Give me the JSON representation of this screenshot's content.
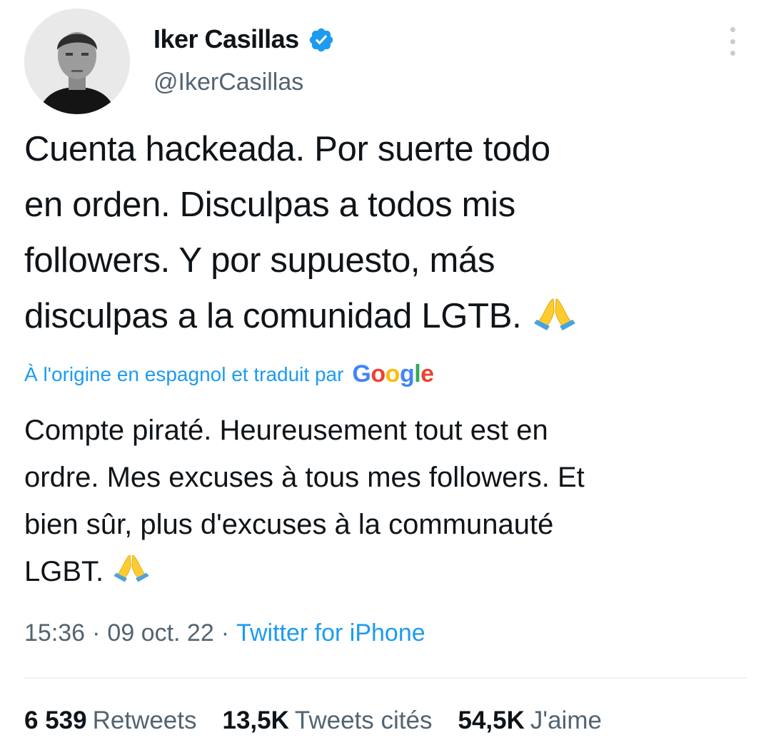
{
  "author": {
    "display_name": "Iker Casillas",
    "handle": "@IkerCasillas",
    "verified": true,
    "verified_color": "#1d9bf0"
  },
  "tweet": {
    "text_lines": [
      "Cuenta hackeada. Por suerte todo",
      "en orden. Disculpas a todos mis",
      "followers. Y por supuesto, más",
      "disculpas a la comunidad LGTB. "
    ],
    "emoji": "folded-hands"
  },
  "translation": {
    "label": "À l'origine en espagnol et traduit par",
    "provider": "Google",
    "text_lines": [
      "Compte piraté. Heureusement tout est en",
      "ordre. Mes excuses à tous mes followers. Et",
      "bien sûr, plus d'excuses à la communauté",
      "LGBT. "
    ]
  },
  "meta": {
    "time": "15:36",
    "separator": "·",
    "date": "09 oct. 22",
    "source": "Twitter for iPhone"
  },
  "stats": {
    "retweets_count": "6 539",
    "retweets_label": "Retweets",
    "quotes_count": "13,5K",
    "quotes_label": "Tweets cités",
    "likes_count": "54,5K",
    "likes_label": "J'aime"
  },
  "colors": {
    "text": "#0f1419",
    "secondary": "#536471",
    "link": "#1d9bf0"
  }
}
